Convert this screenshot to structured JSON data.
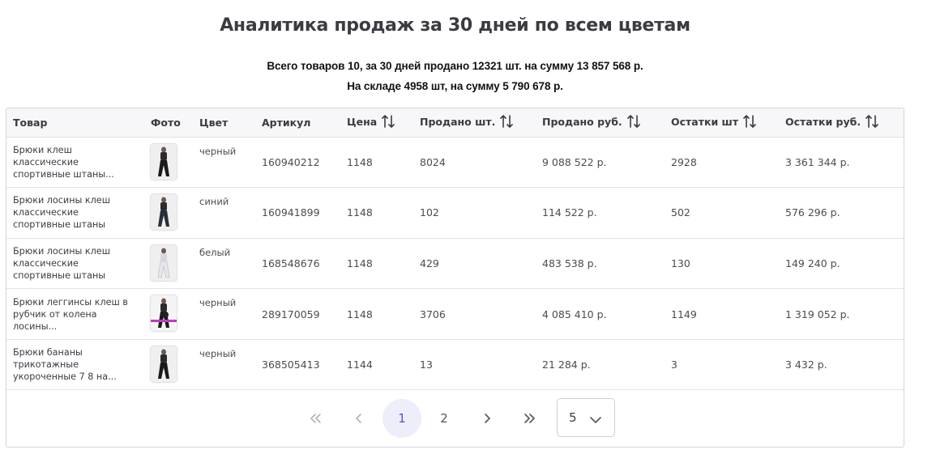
{
  "title": "Аналитика продаж за 30 дней по всем цветам",
  "summary": {
    "line1": "Всего товаров 10, за 30 дней продано 12321 шт. на сумму 13 857 568 р.",
    "line2": "На складе 4958 шт, на сумму 5 790 678 р."
  },
  "table": {
    "headers": {
      "product": "Товар",
      "photo": "Фото",
      "color": "Цвет",
      "article": "Артикул",
      "price": "Цена",
      "sold_qty": "Продано шт.",
      "sold_rub": "Продано руб.",
      "stock_qty": "Остатки шт",
      "stock_rub": "Остатки руб."
    },
    "rows": [
      {
        "name": "Брюки клеш классические спортивные штаны...",
        "color": "черный",
        "article": "160940212",
        "price": "1148",
        "sold_qty": "8024",
        "sold_rub": "9 088 522 р.",
        "stock_qty": "2928",
        "stock_rub": "3 361 344 р."
      },
      {
        "name": "Брюки лосины клеш классические спортивные штаны",
        "color": "синий",
        "article": "160941899",
        "price": "1148",
        "sold_qty": "102",
        "sold_rub": "114 522 р.",
        "stock_qty": "502",
        "stock_rub": "576 296 р."
      },
      {
        "name": "Брюки лосины клеш классические спортивные штаны",
        "color": "белый",
        "article": "168548676",
        "price": "1148",
        "sold_qty": "429",
        "sold_rub": "483 538 р.",
        "stock_qty": "130",
        "stock_rub": "149 240 р."
      },
      {
        "name": "Брюки леггинсы клеш в рубчик от колена лосины...",
        "color": "черный",
        "article": "289170059",
        "price": "1148",
        "sold_qty": "3706",
        "sold_rub": "4 085 410 р.",
        "stock_qty": "1149",
        "stock_rub": "1 319 052 р."
      },
      {
        "name": "Брюки бананы трикотажные укороченные 7 8 на...",
        "color": "черный",
        "article": "368505413",
        "price": "1144",
        "sold_qty": "13",
        "sold_rub": "21 284 р.",
        "stock_qty": "3",
        "stock_rub": "3 432 р."
      }
    ]
  },
  "pagination": {
    "pages": [
      "1",
      "2"
    ],
    "current": "1",
    "per_page": "5",
    "icons": [
      "double-chevron-left-icon",
      "chevron-left-icon",
      "chevron-right-icon",
      "double-chevron-right-icon"
    ]
  },
  "colors": {
    "accent": "#5b55c7",
    "active_page_bg": "#eeeefb",
    "border": "#d4d4d8"
  }
}
